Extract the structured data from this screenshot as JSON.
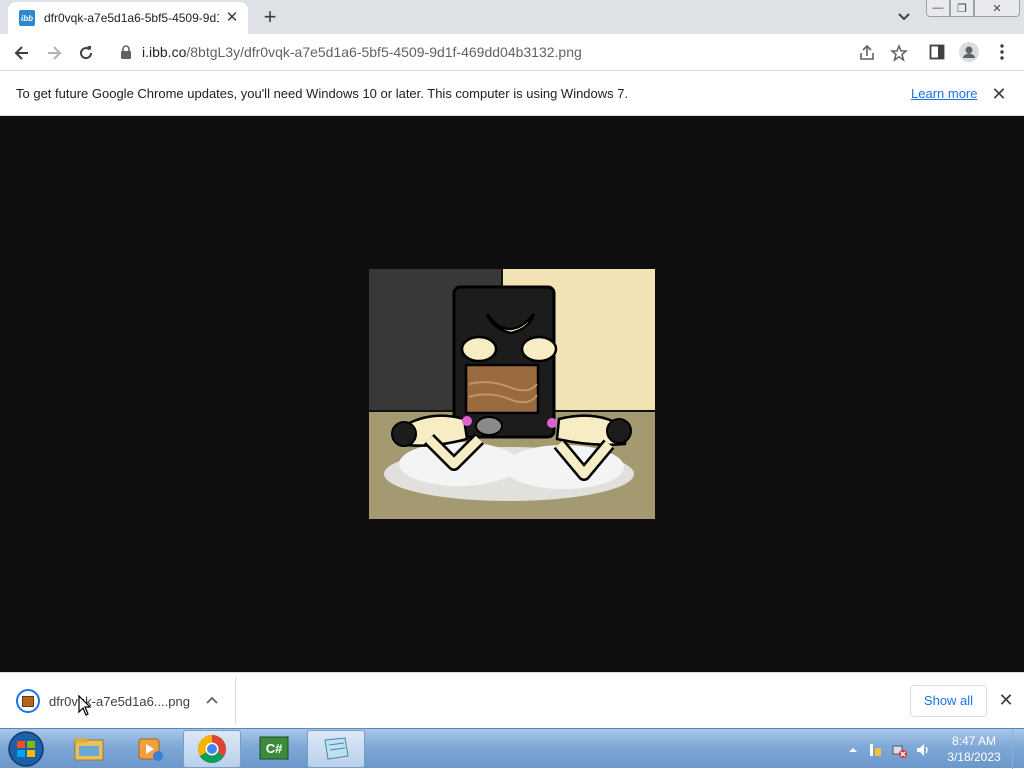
{
  "tab": {
    "title": "dfr0vqk-a7e5d1a6-5bf5-4509-9d1f-469dd04b3132.png",
    "favicon_text": "ibb",
    "close": "✕",
    "new_tab": "+"
  },
  "window_controls": {
    "minimize": "—",
    "restore": "❐",
    "close": "✕"
  },
  "toolbar": {
    "url_host": "i.ibb.co",
    "url_path": "/8btgL3y/dfr0vqk-a7e5d1a6-5bf5-4509-9d1f-469dd04b3132.png",
    "icons": [
      "back-icon",
      "forward-icon",
      "reload-icon",
      "lock-icon",
      "share-icon",
      "bookmark-star-icon",
      "side-panel-icon",
      "profile-icon",
      "menu-icon"
    ]
  },
  "infobar": {
    "message": "To get future Google Chrome updates, you'll need Windows 10 or later. This computer is using Windows 7.",
    "learn_more": "Learn more",
    "close": "✕"
  },
  "content": {
    "background": "#0e0e0e"
  },
  "download_shelf": {
    "file_name": "dfr0vqk-a7e5d1a6....png",
    "show_all": "Show all",
    "close": "✕"
  },
  "taskbar": {
    "apps": [
      "start-orb",
      "explorer",
      "media-player",
      "chrome",
      "csharp-editor",
      "notepad"
    ],
    "clock_time": "8:47 AM",
    "clock_date": "3/18/2023"
  },
  "colors": {
    "accent": "#1a73e8",
    "tabstrip": "#dee1e6",
    "taskbar": "#7fa8d6"
  }
}
